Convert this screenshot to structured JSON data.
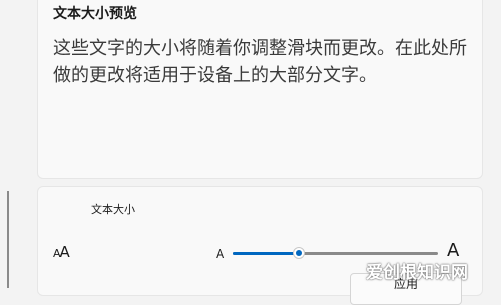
{
  "preview": {
    "title": "文本大小预览",
    "text": "这些文字的大小将随着你调整滑块而更改。在此处所做的更改将适用于设备上的大部分文字。"
  },
  "text_size": {
    "label": "文本大小",
    "icon": "text-size-icon",
    "slider": {
      "min_label": "A",
      "max_label": "A",
      "value_fraction": 0.32,
      "accent_color": "#0067c0"
    },
    "apply_label": "应用"
  },
  "watermark": "爱创根知识网"
}
